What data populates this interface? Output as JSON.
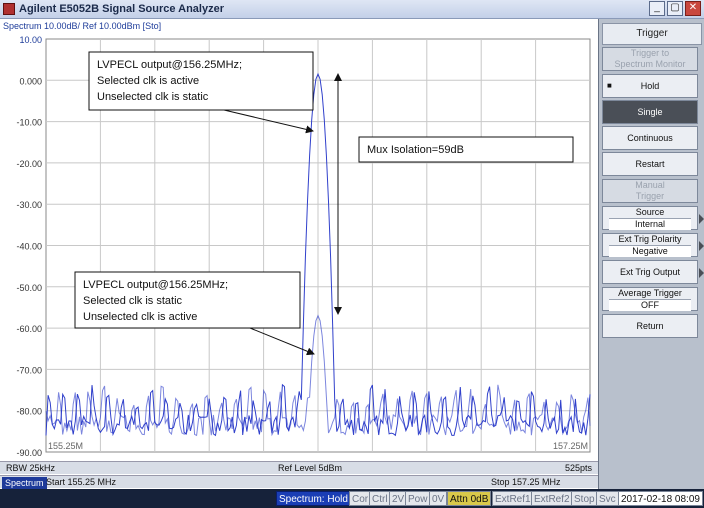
{
  "window": {
    "title": "Agilent E5052B Signal Source Analyzer"
  },
  "trace": {
    "title": "Spectrum 10.00dB/ Ref 10.00dBm [Sto]"
  },
  "chart_data": {
    "type": "line",
    "x_unit": "MHz",
    "xlim": [
      155.25,
      157.25
    ],
    "ylim": [
      -90,
      10
    ],
    "y_ticks": [
      "10.00",
      "0.000",
      "-10.00",
      "-20.00",
      "-30.00",
      "-40.00",
      "-50.00",
      "-60.00",
      "-70.00",
      "-80.00",
      "-90.00"
    ],
    "x_tick_labels": {
      "start": "155.25M",
      "stop": "157.25M"
    },
    "grid": true,
    "series": [
      {
        "color": "#2536c8",
        "peak_x": 156.25,
        "peak_y": 1.5,
        "floor": -86
      },
      {
        "color": "#2536c8",
        "peak_x": 156.25,
        "peak_y": -57,
        "floor": -86
      }
    ],
    "annotations": [
      {
        "lines": [
          "LVPECL output@156.25MHz;",
          "Selected clk is active",
          "Unselected clk is static"
        ]
      },
      {
        "lines": [
          "Mux Isolation=59dB"
        ]
      },
      {
        "lines": [
          "LVPECL output@156.25MHz;",
          "Selected clk is static",
          "Unselected clk is active"
        ]
      }
    ]
  },
  "info": {
    "rbw": "RBW 25kHz",
    "ref_level": "Ref Level 5dBm",
    "points": "525pts",
    "tab": "Spectrum",
    "start": "Start 155.25 MHz",
    "stop": "Stop 157.25 MHz",
    "stop_suffix": "Svc"
  },
  "softkeys": {
    "header": "Trigger",
    "trigger_to_l1": "Trigger to",
    "trigger_to_l2": "Spectrum Monitor",
    "hold": "Hold",
    "single": "Single",
    "continuous": "Continuous",
    "restart": "Restart",
    "manual_l1": "Manual",
    "manual_l2": "Trigger",
    "source_l1": "Source",
    "source_l2": "Internal",
    "polarity_l1": "Ext Trig Polarity",
    "polarity_l2": "Negative",
    "ext_output": "Ext Trig Output",
    "average_l1": "Average Trigger",
    "average_l2": "OFF",
    "return": "Return"
  },
  "status": {
    "mode": "Spectrum: Hold",
    "cor": "Cor",
    "ctrl": "Ctrl",
    "v2": "2V",
    "pow": "Pow",
    "v0": "0V",
    "attn": "Attn 0dB",
    "extref1": "ExtRef1",
    "extref2": "ExtRef2",
    "stop": "Stop",
    "svc": "Svc",
    "datetime": "2017-02-18 08:09"
  }
}
